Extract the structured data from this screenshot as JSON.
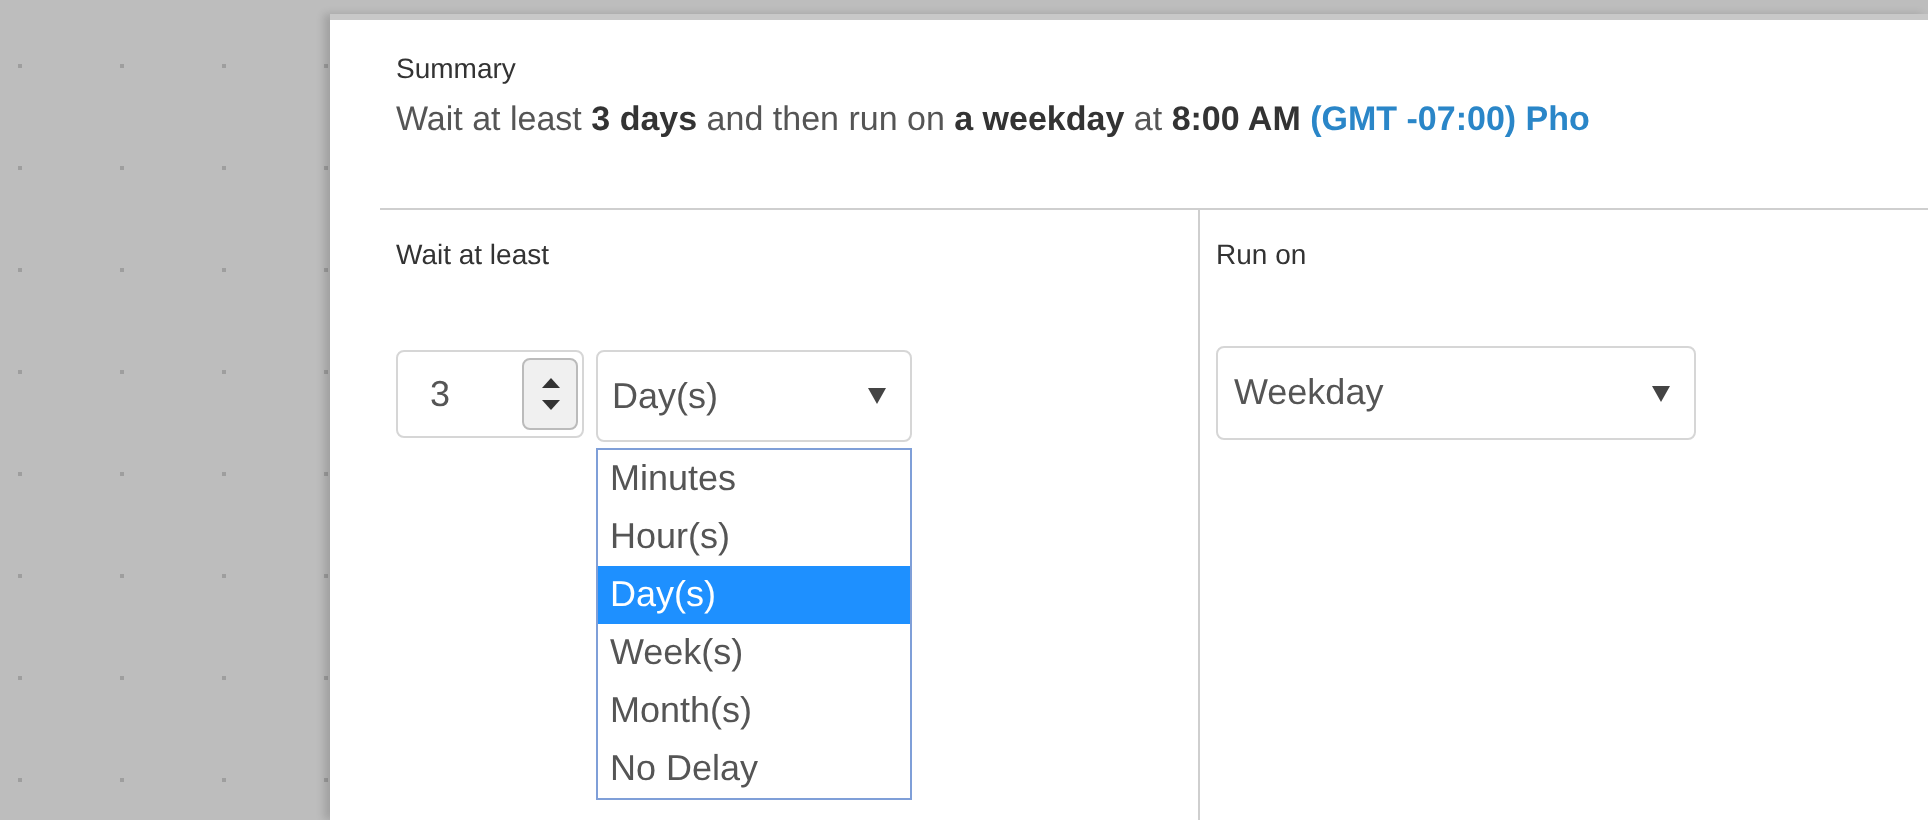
{
  "summary": {
    "label": "Summary",
    "text": "Wait at least **3 days** and then run on **a weekday** at **8:00 AM**",
    "timezone_link": "(GMT -07:00) Pho"
  },
  "wait": {
    "label": "Wait at least",
    "amount": "3",
    "unit": {
      "value": "Day(s)",
      "expanded": true,
      "options": [
        {
          "label": "Minutes",
          "selected": false
        },
        {
          "label": "Hour(s)",
          "selected": false
        },
        {
          "label": "Day(s)",
          "selected": true
        },
        {
          "label": "Week(s)",
          "selected": false
        },
        {
          "label": "Month(s)",
          "selected": false
        },
        {
          "label": "No Delay",
          "selected": false
        }
      ]
    }
  },
  "run_on": {
    "label": "Run on",
    "value": "Weekday"
  }
}
